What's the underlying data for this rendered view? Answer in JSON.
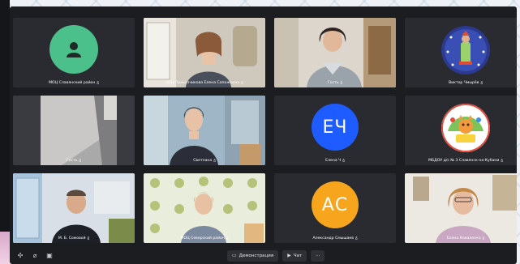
{
  "colors": {
    "window_bg": "#1c1d21",
    "tile_bg": "#2a2b30",
    "active_border": "#f2c23a",
    "avatar_green": "#4cc08a",
    "avatar_blue": "#1e5cff",
    "avatar_orange": "#f7a51c"
  },
  "participants": [
    {
      "name": "МОЦ Славянский район",
      "type": "avatar-icon",
      "icon": "person-icon"
    },
    {
      "name": "ЗОЦ Приказчикова Елена Сапожкина",
      "type": "video",
      "active": true
    },
    {
      "name": "Гость",
      "type": "video"
    },
    {
      "name": "Виктор Чмырёв",
      "type": "logo",
      "icon": "star-badge-icon"
    },
    {
      "name": "Гость",
      "type": "video"
    },
    {
      "name": "Светлана",
      "type": "video"
    },
    {
      "name": "Елена Ч",
      "type": "avatar-initials",
      "initials": "ЕЧ"
    },
    {
      "name": "МБДОУ д/с № 3 Славянск-на-Кубани",
      "type": "logo",
      "icon": "kindergarten-logo-icon"
    },
    {
      "name": "М. Б. Сомовой",
      "type": "video"
    },
    {
      "name": "МОЦ Северский район",
      "type": "video"
    },
    {
      "name": "Александр Смышаев",
      "type": "avatar-initials",
      "initials": "АС"
    },
    {
      "name": "Елена Коваленко",
      "type": "video"
    }
  ],
  "toolbar": {
    "demo_label": "Демонстрация",
    "chat_label": "Чат",
    "more_label": "···"
  }
}
